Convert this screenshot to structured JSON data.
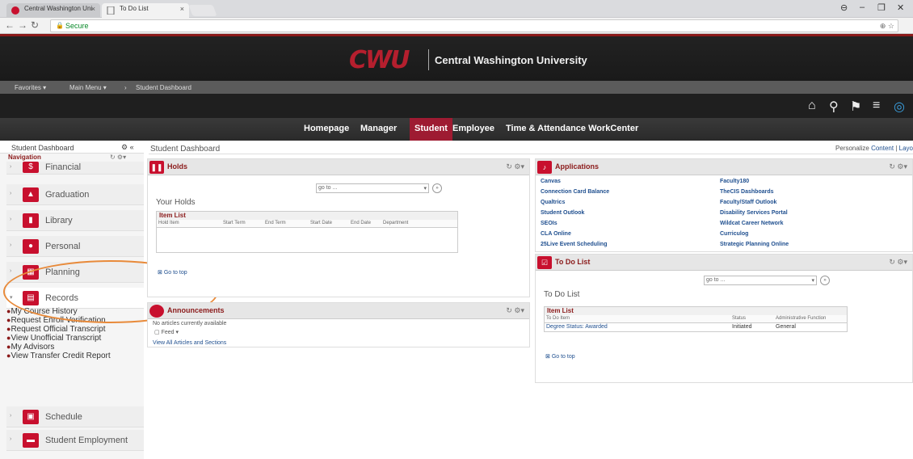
{
  "browser": {
    "tabs": [
      {
        "title": "Central Washington Uni"
      },
      {
        "title": "To Do List"
      }
    ],
    "address": "Secure"
  },
  "banner": {
    "logo": "CWU",
    "title": "Central Washington University"
  },
  "breadcrumb": {
    "favorites": "Favorites ▾",
    "main_menu": "Main Menu ▾",
    "separator": "›",
    "current": "Student Dashboard"
  },
  "top_nav": [
    "Homepage",
    "Manager",
    "Student",
    "Employee",
    "Time & Attendance WorkCenter"
  ],
  "sidebar": {
    "header": "Student Dashboard",
    "nav_label": "Navigation",
    "items": [
      {
        "label": "Financial",
        "icon": "dollar-icon"
      },
      {
        "label": "Graduation",
        "icon": "graduation-cap-icon"
      },
      {
        "label": "Library",
        "icon": "library-icon"
      },
      {
        "label": "Personal",
        "icon": "person-icon"
      },
      {
        "label": "Planning",
        "icon": "planning-icon"
      },
      {
        "label": "Records",
        "icon": "records-icon"
      }
    ],
    "records_sub": [
      "My Course History",
      "Request Enroll Verification",
      "Request Official Transcript",
      "View Unofficial Transcript",
      "My Advisors",
      "View Transfer Credit Report"
    ],
    "items_after": [
      {
        "label": "Schedule",
        "icon": "calendar-icon"
      },
      {
        "label": "Student Employment",
        "icon": "briefcase-icon"
      }
    ]
  },
  "main": {
    "header": "Student Dashboard",
    "personalize": "Personalize",
    "content": "Content",
    "layout": "Layo"
  },
  "holds": {
    "title": "Holds",
    "goto": "go to ...",
    "your_holds": "Your Holds",
    "item_list": "Item List",
    "columns": [
      "Hold Item",
      "Start Term",
      "End Term",
      "Start Date",
      "End Date",
      "Department"
    ],
    "go_to_top": "Go to top"
  },
  "announcements": {
    "title": "Announcements",
    "no_articles": "No articles currently available",
    "feed": "Feed",
    "view_all": "View All Articles and Sections"
  },
  "applications": {
    "title": "Applications",
    "left": [
      "Canvas",
      "Connection Card Balance",
      "Qualtrics",
      "Student Outlook",
      "SEOIs",
      "CLA Online",
      "25Live Event Scheduling"
    ],
    "right": [
      "Faculty180",
      "TheCIS Dashboards",
      "Faculty/Staff Outlook",
      "Disability Services Portal",
      "Wildcat Career Network",
      "Curriculog",
      "Strategic Planning Online"
    ]
  },
  "todo": {
    "title": "To Do List",
    "goto": "go to ...",
    "sub_title": "To Do List",
    "item_list": "Item List",
    "columns": [
      "To Do Item",
      "Status",
      "Administrative Function"
    ],
    "rows": [
      {
        "item": "Degree Status: Awarded",
        "status": "Initiated",
        "function": "General"
      }
    ],
    "go_to_top": "Go to top"
  },
  "colors": {
    "brand": "#9e1b32",
    "annotation": "#e88a3a"
  }
}
